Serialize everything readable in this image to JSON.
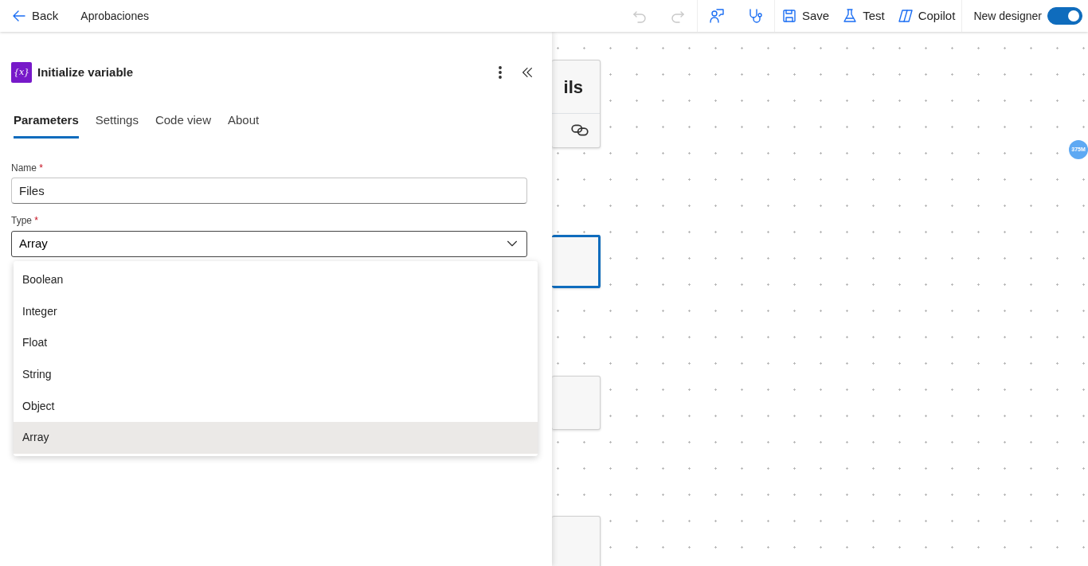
{
  "topbar": {
    "back": "Back",
    "title": "Aprobaciones",
    "actions": [
      {
        "kind": "undo",
        "disabled": true
      },
      {
        "kind": "redo",
        "disabled": true
      },
      {
        "kind": "feedback",
        "disabled": false
      },
      {
        "kind": "checker",
        "disabled": false
      },
      {
        "kind": "save",
        "label": "Save",
        "disabled": false
      },
      {
        "kind": "test",
        "label": "Test",
        "disabled": false
      },
      {
        "kind": "copilot",
        "label": "Copilot",
        "disabled": false
      }
    ],
    "toggle": {
      "label": "New designer",
      "on": true
    }
  },
  "panel": {
    "title": "Initialize variable",
    "icon": "{x}",
    "tabs": [
      {
        "label": "Parameters",
        "selected": true
      },
      {
        "label": "Settings",
        "selected": false
      },
      {
        "label": "Code view",
        "selected": false
      },
      {
        "label": "About",
        "selected": false
      }
    ],
    "name_field": {
      "label": "Name",
      "required_mark": "*",
      "value": "Files"
    },
    "type_field": {
      "label": "Type",
      "required_mark": "*",
      "value": "Array",
      "expanded": true,
      "options": [
        {
          "label": "Boolean",
          "selected": false
        },
        {
          "label": "Integer",
          "selected": false
        },
        {
          "label": "Float",
          "selected": false
        },
        {
          "label": "String",
          "selected": false
        },
        {
          "label": "Object",
          "selected": false
        },
        {
          "label": "Array",
          "selected": true
        }
      ]
    }
  },
  "canvas": {
    "nodes": [
      {
        "text": "ils",
        "has_link": true,
        "selected": false
      },
      {
        "selected": true
      },
      {
        "selected": false
      },
      {
        "selected": false
      }
    ],
    "zoom_badge": "375M"
  }
}
